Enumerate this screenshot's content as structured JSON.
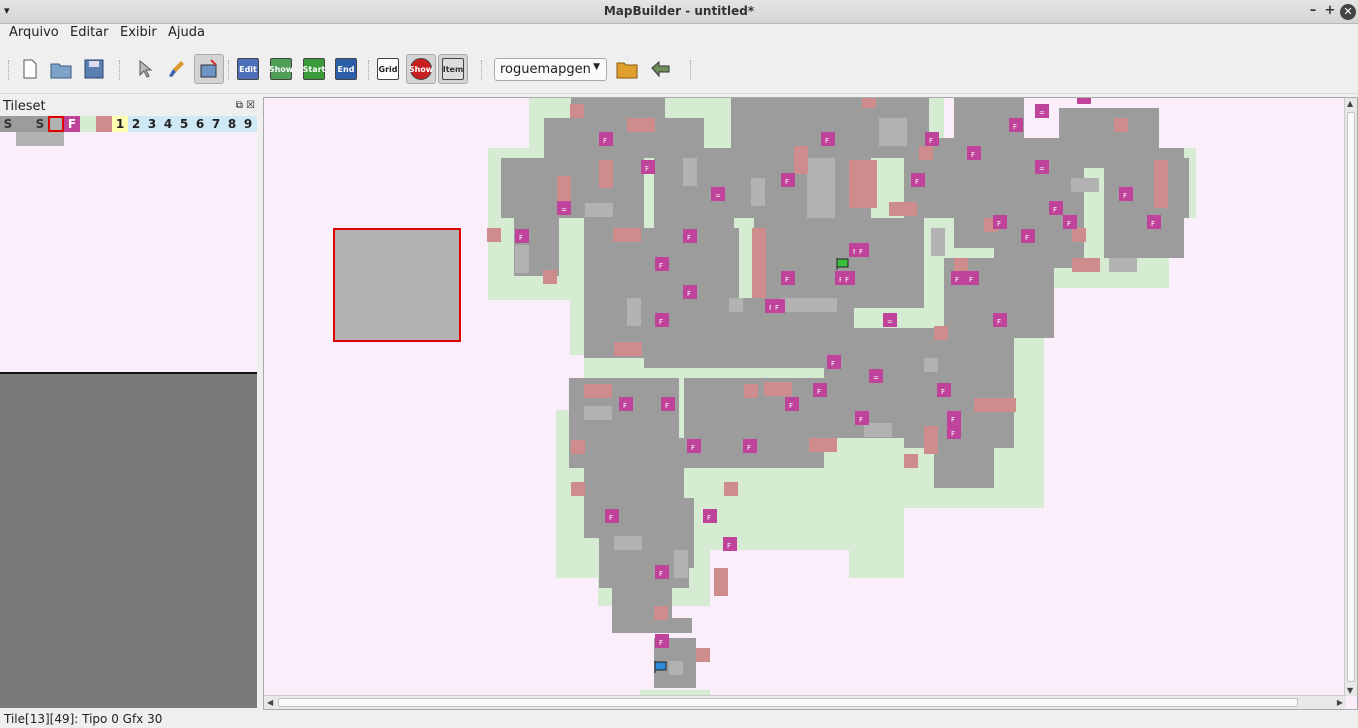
{
  "window": {
    "title": "MapBuilder - untitled*"
  },
  "menu": [
    "Arquivo",
    "Editar",
    "Exibir",
    "Ajuda"
  ],
  "toolbar": {
    "buttons": [
      {
        "name": "new-file-icon",
        "label": ""
      },
      {
        "name": "open-file-icon",
        "label": ""
      },
      {
        "name": "save-file-icon",
        "label": ""
      },
      {
        "name": "select-pointer-icon",
        "label": ""
      },
      {
        "name": "paint-brush-icon",
        "label": ""
      },
      {
        "name": "fill-selection-icon",
        "label": ""
      },
      {
        "name": "edit-mode-icon",
        "label": "Edit"
      },
      {
        "name": "show-mode-icon",
        "label": "Show"
      },
      {
        "name": "start-flag-icon",
        "label": "Start"
      },
      {
        "name": "end-flag-icon",
        "label": "End"
      },
      {
        "name": "grid-toggle-icon",
        "label": "Grid"
      },
      {
        "name": "overlay-toggle-icon",
        "label": "Show"
      },
      {
        "name": "item-tool-icon",
        "label": "Item"
      }
    ],
    "generator": "roguemapgen",
    "folder_button": "open-folder-icon",
    "apply_button": "apply-generator-icon"
  },
  "tileset": {
    "title": "Tileset",
    "digits": [
      "1",
      "2",
      "3",
      "4",
      "5",
      "6",
      "7",
      "8",
      "9"
    ],
    "wall_glyph": "S",
    "floor_glyph": "F"
  },
  "status": "Tile[13][49]: Tipo 0 Gfx 30",
  "colors": {
    "background": "#fbeefb",
    "border_tile": "#d6ecd2",
    "wall_tile": "#9c9c9c",
    "light_tile": "#b2b2b2",
    "red_tile": "#cf8c8c",
    "flag_tile": "#c0439b",
    "selection": "#e00000"
  }
}
